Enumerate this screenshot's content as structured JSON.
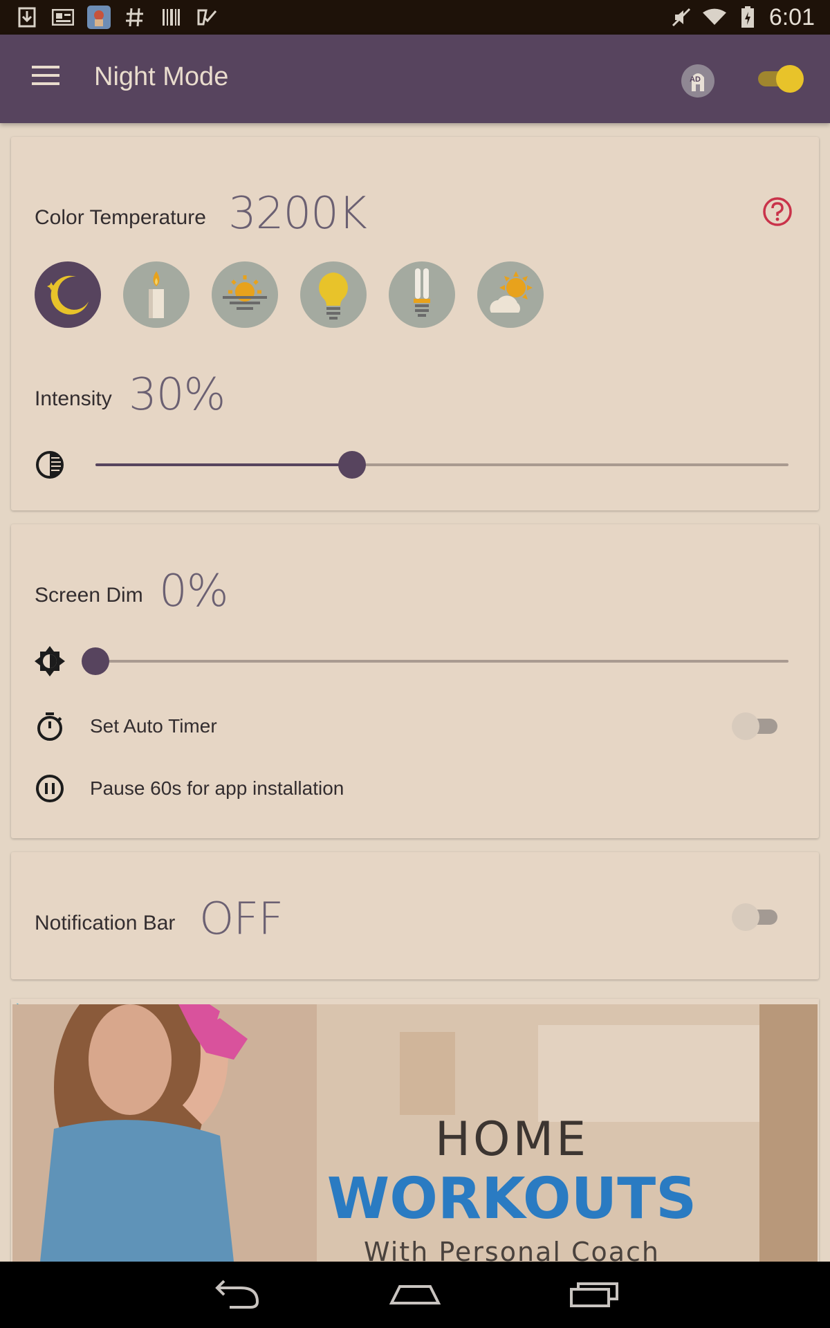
{
  "status_bar": {
    "time": "6:01",
    "left_icons": [
      "download-icon",
      "news-icon",
      "app-icon",
      "hashtag-icon",
      "barcode-icon",
      "checklist-icon"
    ],
    "right_icons": [
      "mute-icon",
      "wifi-icon",
      "battery-icon"
    ]
  },
  "app_bar": {
    "title": "Night Mode",
    "ad_badge": "AD",
    "master_switch_on": true
  },
  "color_temperature": {
    "label": "Color Temperature",
    "value": "3200K",
    "presets": [
      {
        "name": "moon",
        "active": true
      },
      {
        "name": "candle",
        "active": false
      },
      {
        "name": "sunset",
        "active": false
      },
      {
        "name": "bulb",
        "active": false
      },
      {
        "name": "fluorescent",
        "active": false
      },
      {
        "name": "daylight",
        "active": false
      }
    ]
  },
  "intensity": {
    "label": "Intensity",
    "value": "30%",
    "level": 0.37
  },
  "screen_dim": {
    "label": "Screen Dim",
    "value": "0%",
    "level": 0
  },
  "auto_timer": {
    "label": "Set Auto Timer",
    "enabled": false
  },
  "pause": {
    "label": "Pause 60s for app installation"
  },
  "notification_bar": {
    "label": "Notification Bar",
    "value": "OFF",
    "enabled": false
  },
  "ad": {
    "line1": "HOME",
    "line2": "WORKOUTS",
    "line3": "With Personal Coach"
  },
  "colors": {
    "primary": "#57445e",
    "accent": "#e8c32a",
    "help": "#c9334a",
    "background": "#e4d6c5"
  }
}
